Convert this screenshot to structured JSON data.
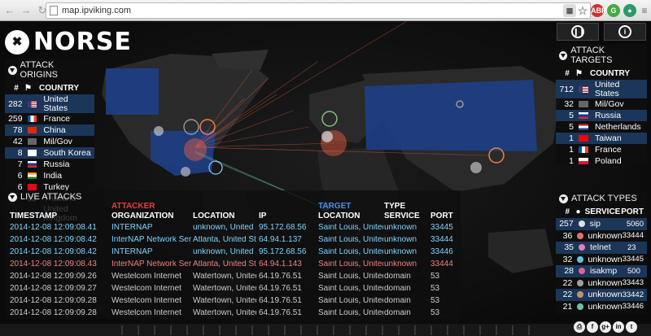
{
  "browser": {
    "url": "map.ipviking.com",
    "ext_abp": "ABP",
    "ext_g": "G"
  },
  "logo": {
    "text": "NORSE"
  },
  "attack_origins": {
    "title": "ATTACK ORIGINS",
    "col_count": "#",
    "col_country": "COUNTRY",
    "rows": [
      {
        "count": "282",
        "country": "United States",
        "flag": "us"
      },
      {
        "count": "259",
        "country": "France",
        "flag": "fr"
      },
      {
        "count": "78",
        "country": "China",
        "flag": "cn"
      },
      {
        "count": "42",
        "country": "Mil/Gov",
        "flag": "mil"
      },
      {
        "count": "8",
        "country": "South Korea",
        "flag": "kr"
      },
      {
        "count": "7",
        "country": "Russia",
        "flag": "ru"
      },
      {
        "count": "6",
        "country": "India",
        "flag": "in"
      },
      {
        "count": "6",
        "country": "Turkey",
        "flag": "tr"
      },
      {
        "count": "",
        "country": "Thailand",
        "flag": "th"
      },
      {
        "count": "",
        "country": "United Kingdom",
        "flag": "gb"
      }
    ]
  },
  "attack_targets": {
    "title": "ATTACK TARGETS",
    "col_count": "#",
    "col_country": "COUNTRY",
    "rows": [
      {
        "count": "712",
        "country": "United States",
        "flag": "us"
      },
      {
        "count": "32",
        "country": "Mil/Gov",
        "flag": "mil"
      },
      {
        "count": "5",
        "country": "Russia",
        "flag": "ru"
      },
      {
        "count": "5",
        "country": "Netherlands",
        "flag": "nl"
      },
      {
        "count": "1",
        "country": "Taiwan",
        "flag": "tw"
      },
      {
        "count": "1",
        "country": "France",
        "flag": "fr"
      },
      {
        "count": "1",
        "country": "Poland",
        "flag": "pl"
      }
    ]
  },
  "attack_types": {
    "title": "ATTACK TYPES",
    "col_count": "#",
    "col_service": "SERVICE",
    "col_port": "PORT",
    "rows": [
      {
        "count": "257",
        "service": "sip",
        "port": "5060",
        "color": "#e0e0e0"
      },
      {
        "count": "36",
        "service": "unknown",
        "port": "33444",
        "color": "#e07070"
      },
      {
        "count": "35",
        "service": "telnet",
        "port": "23",
        "color": "#e080c0"
      },
      {
        "count": "32",
        "service": "unknown",
        "port": "33445",
        "color": "#60c0e0"
      },
      {
        "count": "28",
        "service": "isakmp",
        "port": "500",
        "color": "#e060a0"
      },
      {
        "count": "22",
        "service": "unknown",
        "port": "33443",
        "color": "#a0a0a0"
      },
      {
        "count": "22",
        "service": "unknown",
        "port": "33442",
        "color": "#c09070"
      },
      {
        "count": "21",
        "service": "unknown",
        "port": "33446",
        "color": "#70c0a0"
      }
    ]
  },
  "live_attacks": {
    "title": "LIVE ATTACKS",
    "attacker_label": "ATTACKER",
    "target_label": "TARGET",
    "headers": {
      "timestamp": "TIMESTAMP",
      "org": "ORGANIZATION",
      "location": "LOCATION",
      "ip": "IP",
      "target_location": "LOCATION",
      "service_top": "TYPE",
      "service": "SERVICE",
      "port": "PORT"
    },
    "rows": [
      {
        "ts": "2014-12-08  12:09:08.41",
        "org": "INTERNAP",
        "loc": "unknown, United States",
        "ip": "95.172.68.56",
        "tloc": "Saint Louis, United States",
        "svc": "unknown",
        "port": "33445",
        "color": "#7fd4ff"
      },
      {
        "ts": "2014-12-08  12:09:08.42",
        "org": "InterNAP Network Services, PNAP-",
        "loc": "Atlanta, United States",
        "ip": "64.94.1.137",
        "tloc": "Saint Louis, United States",
        "svc": "unknown",
        "port": "33444",
        "color": "#7fd4ff"
      },
      {
        "ts": "2014-12-08  12:09:08.42",
        "org": "INTERNAP",
        "loc": "unknown, United States",
        "ip": "95.172.68.56",
        "tloc": "Saint Louis, United States",
        "svc": "unknown",
        "port": "33446",
        "color": "#7fd4ff"
      },
      {
        "ts": "2014-12-08  12:09:08.43",
        "org": "InterNAP Network Services, PNAP-",
        "loc": "Atlanta, United States",
        "ip": "64.94.1.143",
        "tloc": "Saint Louis, United States",
        "svc": "unknown",
        "port": "33444",
        "color": "#f08080"
      },
      {
        "ts": "2014-12-08  12:09:09.26",
        "org": "Westelcom Internet",
        "loc": "Watertown, United States",
        "ip": "64.19.76.51",
        "tloc": "Saint Louis, United States",
        "svc": "domain",
        "port": "53",
        "color": "#cccccc"
      },
      {
        "ts": "2014-12-08  12:09:09.27",
        "org": "Westelcom Internet",
        "loc": "Watertown, United States",
        "ip": "64.19.76.51",
        "tloc": "Saint Louis, United States",
        "svc": "domain",
        "port": "53",
        "color": "#cccccc"
      },
      {
        "ts": "2014-12-08  12:09:09.28",
        "org": "Westelcom Internet",
        "loc": "Watertown, United States",
        "ip": "64.19.76.51",
        "tloc": "Saint Louis, United States",
        "svc": "domain",
        "port": "53",
        "color": "#cccccc"
      },
      {
        "ts": "2014-12-08  12:09:09.28",
        "org": "Westelcom Internet",
        "loc": "Watertown, United States",
        "ip": "64.19.76.51",
        "tloc": "Saint Louis, United States",
        "svc": "domain",
        "port": "53",
        "color": "#cccccc"
      }
    ]
  }
}
